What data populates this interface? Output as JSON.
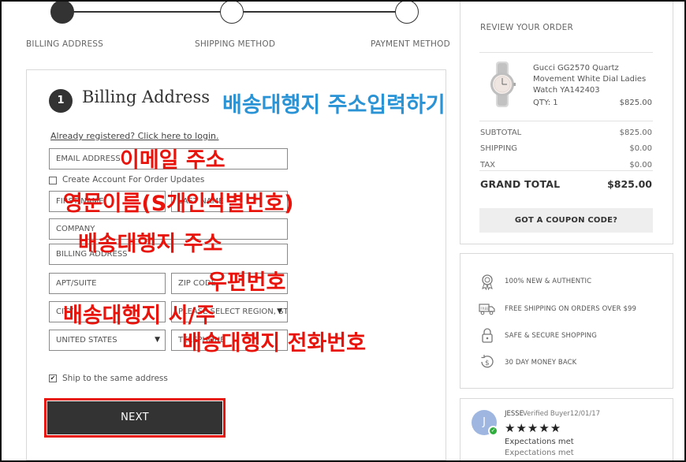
{
  "steps": [
    {
      "label": "BILLING ADDRESS",
      "active": true
    },
    {
      "label": "SHIPPING METHOD",
      "active": false
    },
    {
      "label": "PAYMENT METHOD",
      "active": false
    }
  ],
  "billing": {
    "step_number": "1",
    "title": "Billing Address",
    "login_link": "Already registered? Click here to login.",
    "email_placeholder": "EMAIL ADDRESS",
    "create_account_label": "Create Account For Order Updates",
    "first_name_placeholder": "FIRST NAME",
    "last_name_placeholder": "LAST NAME",
    "company_placeholder": "COMPANY",
    "address_placeholder": "BILLING ADDRESS",
    "apt_placeholder": "APT/SUITE",
    "zip_placeholder": "ZIP CODE",
    "city_placeholder": "CITY",
    "region_value": "PLEASE SELECT REGION, ST.",
    "country_value": "UNITED STATES",
    "phone_placeholder": "TELEPHONE",
    "same_address_label": "Ship to the same address",
    "same_address_checked": "✔",
    "next_label": "NEXT"
  },
  "annotations": {
    "title_note": "배송대행지 주소입력하기",
    "email_note": "이메일 주소",
    "name_note": "영문이름(S개인식별번호)",
    "address_note": "배송대행지 주소",
    "zip_note": "우편번호",
    "city_note": "배송대행지 시/주",
    "phone_note": "배송대행지 전화번호"
  },
  "order": {
    "title": "REVIEW YOUR ORDER",
    "product_name": "Gucci GG2570 Quartz Movement White Dial Ladies Watch YA142403",
    "qty_label": "QTY:  1",
    "qty_price": "$825.00",
    "subtotal_label": "SUBTOTAL",
    "subtotal_value": "$825.00",
    "shipping_label": "SHIPPING",
    "shipping_value": "$0.00",
    "tax_label": "TAX",
    "tax_value": "$0.00",
    "grand_total_label": "GRAND TOTAL",
    "grand_total_value": "$825.00",
    "coupon_label": "GOT A COUPON CODE?"
  },
  "features": [
    {
      "icon": "medal-icon",
      "text": "100% NEW & AUTHENTIC"
    },
    {
      "icon": "truck-icon",
      "text": "FREE SHIPPING ON ORDERS OVER $99"
    },
    {
      "icon": "lock-icon",
      "text": "SAFE & SECURE SHOPPING"
    },
    {
      "icon": "money-back-icon",
      "text": "30 DAY MONEY BACK"
    }
  ],
  "review": {
    "avatar_letter": "J",
    "reviewer": "JESSE",
    "meta": "Verified Buyer12/01/17",
    "stars": "★★★★★",
    "line1": "Expectations met",
    "line2": "Expectations met"
  },
  "colors": {
    "annotation_red": "#e8140c",
    "annotation_blue": "#2a93d5",
    "dark": "#333333"
  }
}
